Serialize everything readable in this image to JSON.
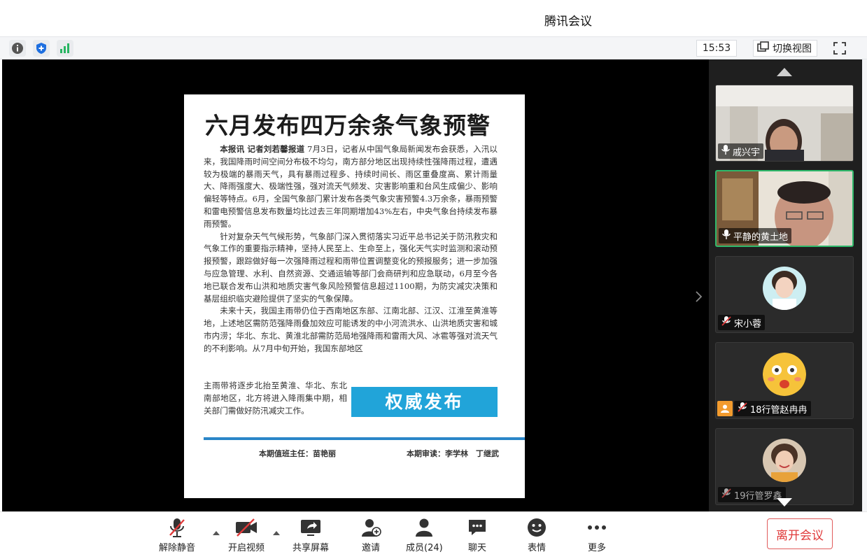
{
  "window": {
    "title": "腾讯会议"
  },
  "toolbar": {
    "info_icon": "info-icon",
    "security_icon": "shield-icon",
    "signal_icon": "signal-bars-icon",
    "clock": "15:53",
    "switch_view_label": "切换视图",
    "fullscreen_icon": "fullscreen-icon"
  },
  "shared_document": {
    "headline": "六月发布四万余条气象预警",
    "lead": "本报讯 记者刘若馨报道",
    "paragraph1": "7月3日，记者从中国气象局新闻发布会获悉，入汛以来，我国降雨时间空间分布极不均匀，南方部分地区出现持续性强降雨过程，遭遇较为极端的暴雨天气，具有暴雨过程多、持续时间长、雨区重叠度高、累计雨量大、降雨强度大、极端性强，强对流天气频发、灾害影响重和台风生成偏少、影响偏轻等特点。6月，全国气象部门累计发布各类气象灾害预警4.3万余条，暴雨预警和雷电预警信息发布数量均比过去三年同期增加43%左右，中央气象台持续发布暴雨预警。",
    "paragraph2": "针对复杂天气气候形势，气象部门深入贯彻落实习近平总书记关于防汛救灾和气象工作的重要指示精神，坚持人民至上、生命至上，强化天气实时监测和滚动预报预警，跟踪做好每一次强降雨过程和雨带位置调整变化的预报服务；进一步加强与应急管理、水利、自然资源、交通运输等部门会商研判和应急联动，6月至今各地已联合发布山洪和地质灾害气象风险预警信息超过1100期，为防灾减灾决策和基层组织临灾避险提供了坚实的气象保障。",
    "paragraph3": "未来十天，我国主雨带仍位于西南地区东部、江南北部、江汉、江淮至黄淮等地，上述地区需防范强降雨叠加效应可能诱发的中小河流洪水、山洪地质灾害和城市内涝；华北、东北、黄淮北部需防范局地强降雨和雷雨大风、冰雹等强对流天气的不利影响。从7月中旬开始，我国东部地区",
    "tail": "主雨带将逐步北抬至黄淮、华北、东北南部地区，北方将进入降雨集中期，相关部门需做好防汛减灾工作。",
    "banner": "权威发布",
    "footer_left": "本期值班主任：苗艳丽",
    "footer_right": "本期审读：李学林　丁继武"
  },
  "participants": [
    {
      "name": "戚兴宇",
      "mic": "on",
      "active": false
    },
    {
      "name": "平静的黄土地",
      "mic": "on",
      "active": true
    },
    {
      "name": "宋小蓉",
      "mic": "muted",
      "active": false
    },
    {
      "name": "18行管赵冉冉",
      "mic": "muted",
      "active": false
    },
    {
      "name": "19行管罗鑫",
      "mic": "muted",
      "active": false
    }
  ],
  "bottom_bar": {
    "unmute": "解除静音",
    "start_video": "开启视频",
    "share_screen": "共享屏幕",
    "invite": "邀请",
    "members": "成员(24)",
    "chat": "聊天",
    "reactions": "表情",
    "more": "更多",
    "leave": "离开会议"
  },
  "colors": {
    "accent_green": "#2fb96b",
    "banner_blue": "#21a4d9",
    "leave_red": "#e03a3a"
  }
}
